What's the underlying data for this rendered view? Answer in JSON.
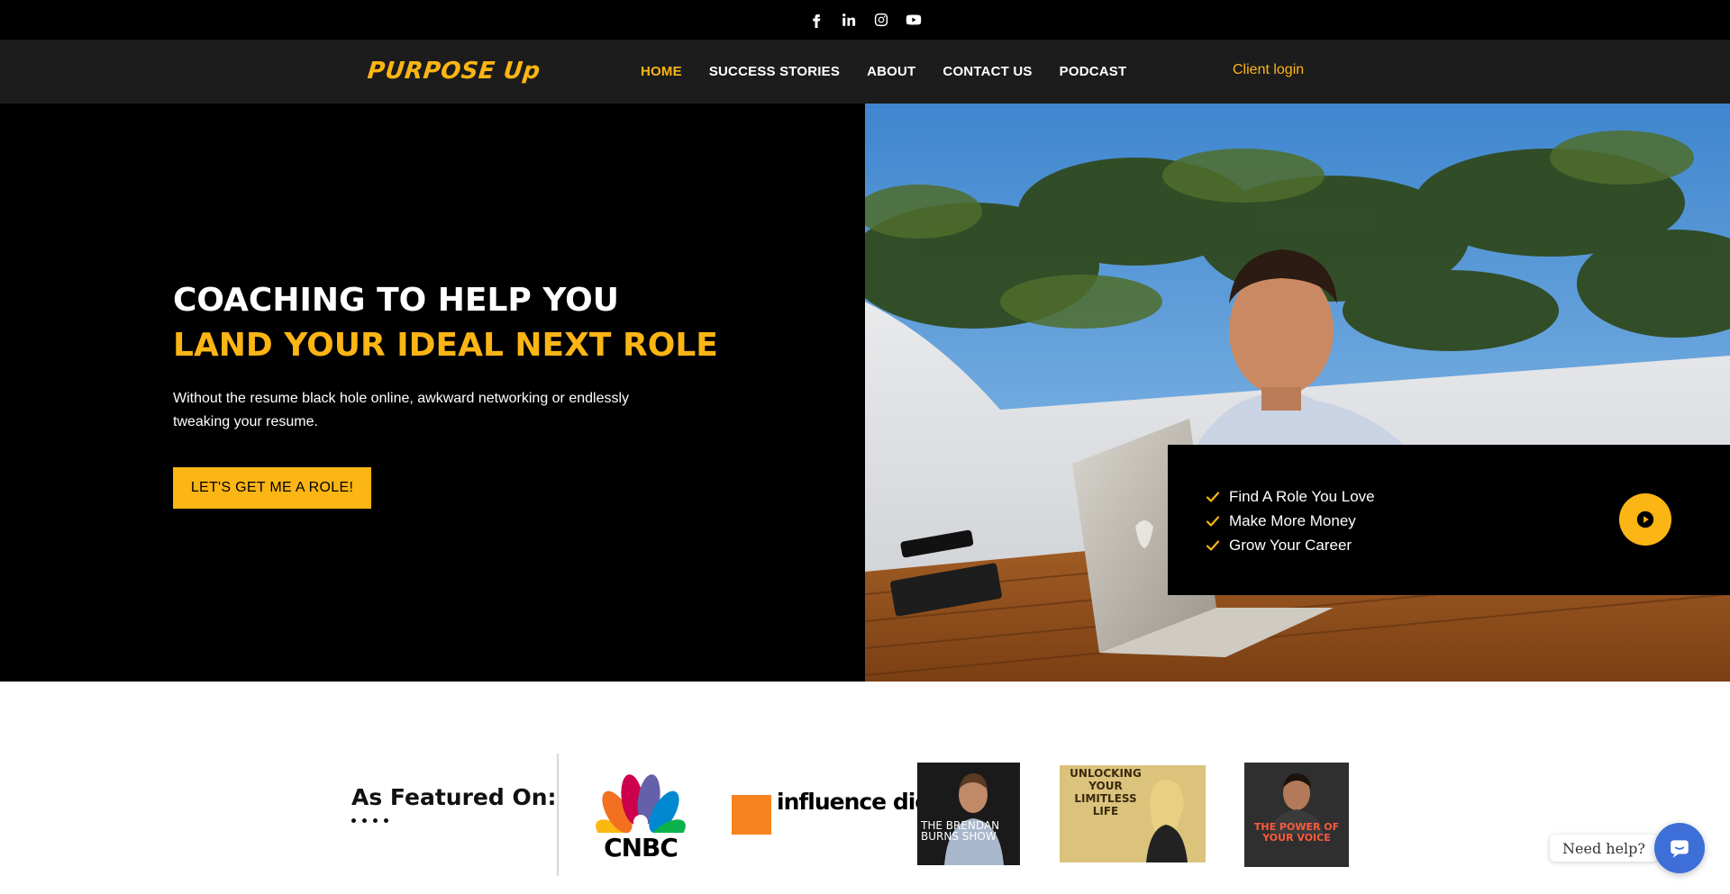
{
  "topbar": {
    "social": [
      {
        "icon": "facebook-icon"
      },
      {
        "icon": "linkedin-icon"
      },
      {
        "icon": "instagram-icon"
      },
      {
        "icon": "youtube-icon"
      }
    ]
  },
  "header": {
    "logo_text": "PURPOSE Up",
    "nav": [
      {
        "label": "HOME",
        "active": true
      },
      {
        "label": "SUCCESS STORIES",
        "active": false
      },
      {
        "label": "ABOUT",
        "active": false
      },
      {
        "label": "CONTACT US",
        "active": false
      },
      {
        "label": "PODCAST",
        "active": false
      }
    ],
    "client_login": "Client login"
  },
  "hero": {
    "title_line1": "COACHING TO HELP YOU",
    "title_line2": "LAND YOUR IDEAL NEXT ROLE",
    "subtitle": "Without the resume black hole online, awkward networking or endlessly tweaking your resume.",
    "cta_label": "LET'S GET ME A ROLE!",
    "benefits": [
      "Find A Role You Love",
      "Make More Money",
      "Grow Your Career"
    ]
  },
  "featured": {
    "title": "As Featured On:",
    "logos": {
      "cnbc": "CNBC",
      "influence": "influence digest +",
      "brendan": "THE BRENDAN BURNS SHOW",
      "limitless": "UNLOCKING YOUR LIMITLESS LIFE",
      "powervoice": "THE POWER OF YOUR VOICE"
    }
  },
  "help": {
    "label": "Need help?"
  },
  "colors": {
    "accent": "#fbb514",
    "dark": "#000000",
    "nav_bg": "#1c1c1c",
    "chat_blue": "#3e6ed8"
  }
}
